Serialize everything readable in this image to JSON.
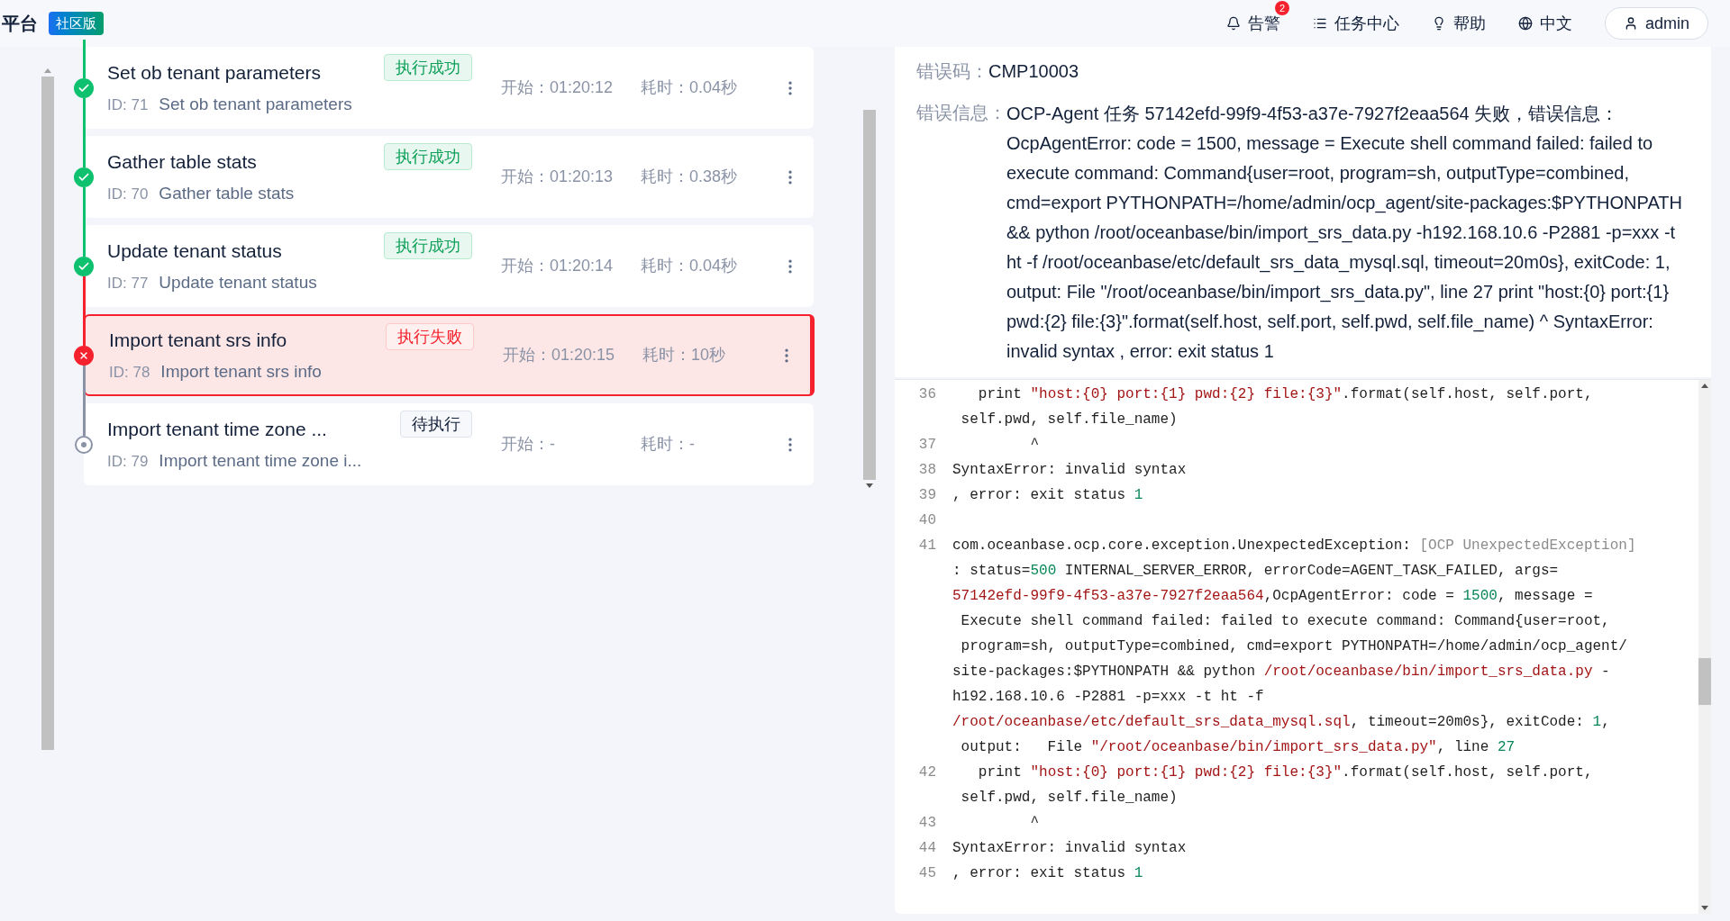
{
  "header": {
    "brand": "平台",
    "edition": "社区版",
    "nav": [
      {
        "kind": "alerts",
        "label": "告警",
        "badge": "2"
      },
      {
        "kind": "tasks",
        "label": "任务中心"
      },
      {
        "kind": "help",
        "label": "帮助"
      },
      {
        "kind": "language",
        "label": "中文"
      }
    ],
    "user": "admin"
  },
  "tasks": [
    {
      "title": "Set ob tenant parameters",
      "kind": "success",
      "status_label": "执行成功",
      "id_label": "ID: 71",
      "name": "Set ob tenant parameters",
      "start_label": "开始：",
      "start": "01:20:12",
      "duration_label": "耗时：",
      "duration": "0.04秒",
      "selected": false
    },
    {
      "title": "Gather table stats",
      "kind": "success",
      "status_label": "执行成功",
      "id_label": "ID: 70",
      "name": "Gather table stats",
      "start_label": "开始：",
      "start": "01:20:13",
      "duration_label": "耗时：",
      "duration": "0.38秒",
      "selected": false
    },
    {
      "title": "Update tenant status",
      "kind": "success",
      "status_label": "执行成功",
      "id_label": "ID: 77",
      "name": "Update tenant status",
      "start_label": "开始：",
      "start": "01:20:14",
      "duration_label": "耗时：",
      "duration": "0.04秒",
      "selected": false
    },
    {
      "title": "Import tenant srs info",
      "kind": "failed",
      "status_label": "执行失败",
      "id_label": "ID: 78",
      "name": "Import tenant srs info",
      "start_label": "开始：",
      "start": "01:20:15",
      "duration_label": "耗时：",
      "duration": "10秒",
      "selected": true
    },
    {
      "title": "Import tenant time zone ...",
      "kind": "pending",
      "status_label": "待执行",
      "id_label": "ID: 79",
      "name": "Import tenant time zone i...",
      "start_label": "开始：",
      "start": "-",
      "duration_label": "耗时：",
      "duration": "-",
      "selected": false
    }
  ],
  "detail": {
    "error_code_label": "错误码：",
    "error_code": "CMP10003",
    "error_info_label": "错误信息：",
    "error_info": "OCP-Agent 任务 57142efd-99f9-4f53-a37e-7927f2eaa564 失败，错误信息：OcpAgentError: code = 1500, message = Execute shell command failed: failed to execute command: Command{user=root, program=sh, outputType=combined, cmd=export PYTHONPATH=/home/admin/ocp_agent/site-packages:$PYTHONPATH && python /root/oceanbase/bin/import_srs_data.py -h192.168.10.6 -P2881 -p=xxx -t ht -f /root/oceanbase/etc/default_srs_data_mysql.sql, timeout=20m0s}, exitCode: 1, output: File \"/root/oceanbase/bin/import_srs_data.py\", line 27 print \"host:{0} port:{1} pwd:{2} file:{3}\".format(self.host, self.port, self.pwd, self.file_name) ^ SyntaxError: invalid syntax , error: exit status 1",
    "log_lines": [
      {
        "number": "36",
        "wrapped_lines": [
          {
            "segments": [
              {
                "kind": "plain",
                "text": "   print "
              },
              {
                "kind": "string",
                "text": "\"host:{0} port:{1} pwd:{2} file:{3}\""
              },
              {
                "kind": "plain",
                "text": ".format(self.host, self.port,"
              }
            ]
          },
          {
            "segments": [
              {
                "kind": "plain",
                "text": " self.pwd, self.file_name)"
              }
            ]
          }
        ]
      },
      {
        "number": "37",
        "wrapped_lines": [
          {
            "segments": [
              {
                "kind": "plain",
                "text": "         ^"
              }
            ]
          }
        ]
      },
      {
        "number": "38",
        "wrapped_lines": [
          {
            "segments": [
              {
                "kind": "plain",
                "text": "SyntaxError: invalid syntax"
              }
            ]
          }
        ]
      },
      {
        "number": "39",
        "wrapped_lines": [
          {
            "segments": [
              {
                "kind": "plain",
                "text": ", error: exit status "
              },
              {
                "kind": "number",
                "text": "1"
              }
            ]
          }
        ]
      },
      {
        "number": "40"
      },
      {
        "number": "41",
        "wrapped_lines": [
          {
            "segments": [
              {
                "kind": "plain",
                "text": "com.oceanbase.ocp.core.exception.UnexpectedException: "
              },
              {
                "kind": "comment",
                "text": "[OCP UnexpectedException]"
              }
            ]
          },
          {
            "segments": [
              {
                "kind": "plain",
                "text": ": status="
              },
              {
                "kind": "number",
                "text": "500"
              },
              {
                "kind": "plain",
                "text": " INTERNAL_SERVER_ERROR, errorCode=AGENT_TASK_FAILED, args="
              }
            ]
          },
          {
            "segments": [
              {
                "kind": "string",
                "text": "57142efd-99f9-4f53-a37e-7927f2eaa564"
              },
              {
                "kind": "plain",
                "text": ",OcpAgentError: code = "
              },
              {
                "kind": "number",
                "text": "1500"
              },
              {
                "kind": "plain",
                "text": ", message ="
              }
            ]
          },
          {
            "segments": [
              {
                "kind": "plain",
                "text": " Execute shell command failed: failed to execute command: Command{user=root,"
              }
            ]
          },
          {
            "segments": [
              {
                "kind": "plain",
                "text": " program=sh, outputType=combined, cmd=export PYTHONPATH=/home/admin/ocp_agent/"
              }
            ]
          },
          {
            "segments": [
              {
                "kind": "plain",
                "text": "site-packages:$PYTHONPATH && python "
              },
              {
                "kind": "string",
                "text": "/root/oceanbase/bin/import_srs_data.py"
              },
              {
                "kind": "plain",
                "text": " -"
              }
            ]
          },
          {
            "segments": [
              {
                "kind": "plain",
                "text": "h192.168.10.6 -P2881 -p=xxx -t ht -f"
              }
            ]
          },
          {
            "segments": [
              {
                "kind": "string",
                "text": "/root/oceanbase/etc/default_srs_data_mysql.sql"
              },
              {
                "kind": "plain",
                "text": ", timeout=20m0s}, exitCode: "
              },
              {
                "kind": "number",
                "text": "1"
              },
              {
                "kind": "plain",
                "text": ","
              }
            ]
          },
          {
            "segments": [
              {
                "kind": "plain",
                "text": " output:   File "
              },
              {
                "kind": "string",
                "text": "\"/root/oceanbase/bin/import_srs_data.py\""
              },
              {
                "kind": "plain",
                "text": ", line "
              },
              {
                "kind": "number",
                "text": "27"
              }
            ]
          }
        ]
      },
      {
        "number": "42",
        "wrapped_lines": [
          {
            "segments": [
              {
                "kind": "plain",
                "text": "   print "
              },
              {
                "kind": "string",
                "text": "\"host:{0} port:{1} pwd:{2} file:{3}\""
              },
              {
                "kind": "plain",
                "text": ".format(self.host, self.port,"
              }
            ]
          },
          {
            "segments": [
              {
                "kind": "plain",
                "text": " self.pwd, self.file_name)"
              }
            ]
          }
        ]
      },
      {
        "number": "43",
        "wrapped_lines": [
          {
            "segments": [
              {
                "kind": "plain",
                "text": "         ^"
              }
            ]
          }
        ]
      },
      {
        "number": "44",
        "wrapped_lines": [
          {
            "segments": [
              {
                "kind": "plain",
                "text": "SyntaxError: invalid syntax"
              }
            ]
          }
        ]
      },
      {
        "number": "45",
        "wrapped_lines": [
          {
            "segments": [
              {
                "kind": "plain",
                "text": ", error: exit status "
              },
              {
                "kind": "number",
                "text": "1"
              }
            ]
          }
        ]
      }
    ]
  }
}
